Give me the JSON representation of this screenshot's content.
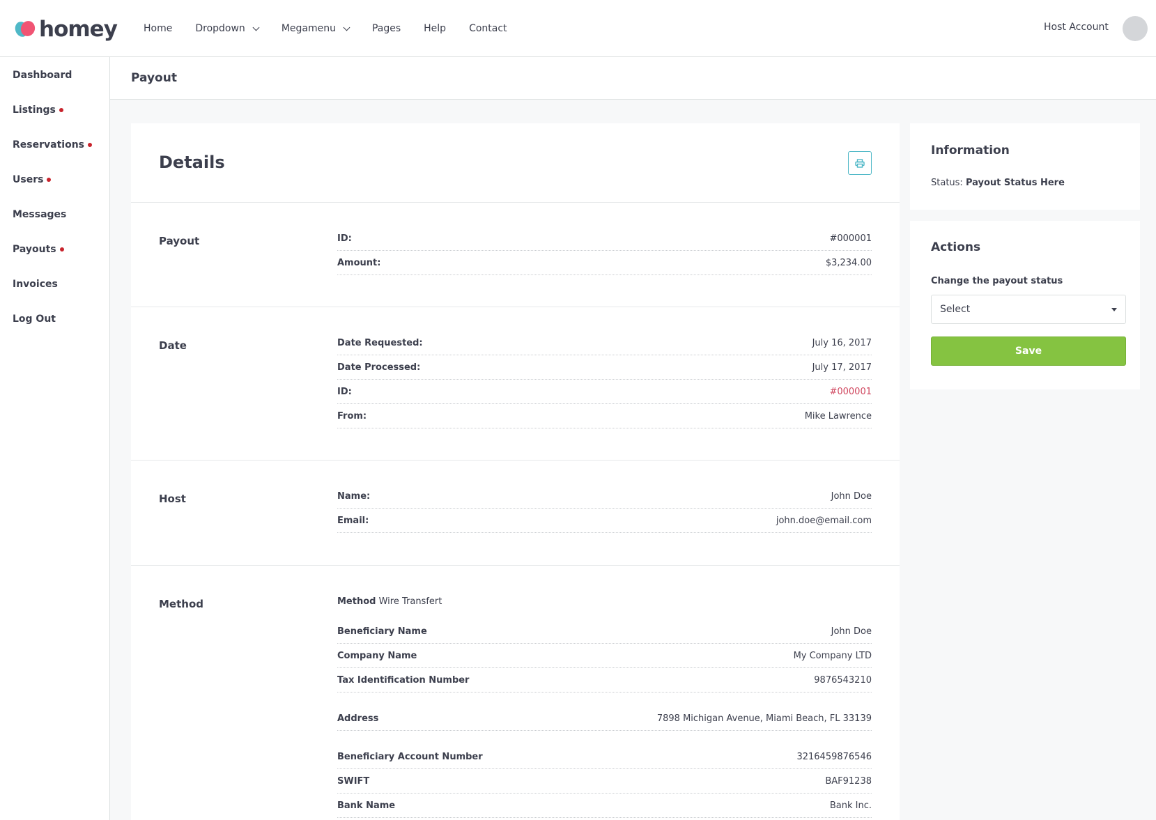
{
  "header": {
    "logo_text": "homey",
    "nav": [
      "Home",
      "Dropdown",
      "Megamenu",
      "Pages",
      "Help",
      "Contact"
    ],
    "host_account": "Host Account"
  },
  "sidebar": {
    "items": [
      {
        "label": "Dashboard"
      },
      {
        "label": "Listings"
      },
      {
        "label": "Reservations"
      },
      {
        "label": "Users"
      },
      {
        "label": "Messages"
      },
      {
        "label": "Payouts"
      },
      {
        "label": "Invoices"
      },
      {
        "label": "Log Out"
      }
    ]
  },
  "page": {
    "title": "Payout"
  },
  "details": {
    "title": "Details",
    "payout": {
      "label": "Payout",
      "rows": [
        {
          "k": "ID:",
          "v": "#000001"
        },
        {
          "k": "Amount:",
          "v": "$3,234.00"
        }
      ]
    },
    "date": {
      "label": "Date",
      "rows": [
        {
          "k": "Date Requested:",
          "v": "July 16, 2017"
        },
        {
          "k": "Date Processed:",
          "v": "July 17, 2017"
        },
        {
          "k": "ID:",
          "v": "#000001"
        },
        {
          "k": "From:",
          "v": "Mike Lawrence"
        }
      ]
    },
    "host": {
      "label": "Host",
      "rows": [
        {
          "k": "Name:",
          "v": "John Doe"
        },
        {
          "k": "Email:",
          "v": "john.doe@email.com"
        }
      ]
    },
    "method": {
      "label": "Method",
      "method_key": "Method",
      "method_value": "Wire Transfert",
      "rows": [
        {
          "k": "Beneficiary Name",
          "v": "John Doe"
        },
        {
          "k": "Company Name",
          "v": "My Company LTD"
        },
        {
          "k": "Tax Identification Number",
          "v": "9876543210"
        },
        {
          "k": "Address",
          "v": "7898 Michigan Avenue, Miami Beach, FL 33139"
        },
        {
          "k": "Beneficiary Account Number",
          "v": "3216459876546"
        },
        {
          "k": "SWIFT",
          "v": "BAF91238"
        },
        {
          "k": "Bank Name",
          "v": "Bank Inc."
        }
      ]
    }
  },
  "information": {
    "title": "Information",
    "status_label": "Status:",
    "status_value": "Payout Status Here"
  },
  "actions": {
    "title": "Actions",
    "field_label": "Change the payout status",
    "select_value": "Select",
    "save_label": "Save"
  }
}
